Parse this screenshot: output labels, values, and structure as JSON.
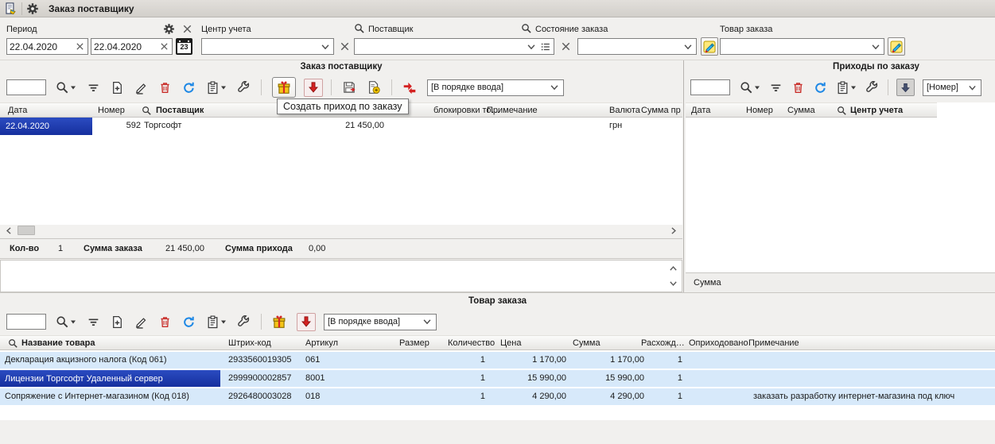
{
  "titlebar": {
    "title": "Заказ поставщику"
  },
  "filterbar": {
    "period": {
      "label": "Период",
      "date_from": "22.04.2020",
      "date_to": "22.04.2020",
      "calendar": "23"
    },
    "center": {
      "label": "Центр учета"
    },
    "supplier": {
      "label": "Поставщик"
    },
    "state": {
      "label": "Состояние заказа"
    },
    "product": {
      "label": "Товар заказа"
    }
  },
  "order_panel": {
    "title": "Заказ поставщику",
    "sort_order": "[В порядке ввода]",
    "tooltip": "Создать приход по заказу",
    "cols": {
      "date": "Дата",
      "number": "Номер",
      "supplier": "Поставщик",
      "block": "блокировки то…",
      "note": "Примечание",
      "currency": "Валюта",
      "sum_receipt": "Сумма пр"
    },
    "row": {
      "date": "22.04.2020",
      "number": "592",
      "supplier": "Торгсофт",
      "sum": "21 450,00",
      "currency": "грн"
    },
    "stats": {
      "count_label": "Кол-во",
      "count": "1",
      "order_sum_label": "Сумма заказа",
      "order_sum": "21 450,00",
      "receipt_sum_label": "Сумма прихода",
      "receipt_sum": "0,00"
    }
  },
  "receipts_panel": {
    "title": "Приходы по заказу",
    "sort_order": "[Номер]",
    "cols": {
      "date": "Дата",
      "number": "Номер",
      "sum": "Сумма",
      "center": "Центр учета"
    },
    "footer": {
      "sum_label": "Сумма"
    }
  },
  "product_panel": {
    "title": "Товар заказа",
    "sort_order": "[В порядке ввода]",
    "cols": {
      "name": "Название товара",
      "barcode": "Штрих-код",
      "article": "Артикул",
      "size": "Размер",
      "qty": "Количество",
      "price": "Цена",
      "sum": "Сумма",
      "diff": "Расхожд…",
      "received": "Оприходовано",
      "note": "Примечание"
    },
    "rows": [
      {
        "name": "Декларация акцизного налога (Код 061)",
        "barcode": "2933560019305",
        "article": "061",
        "qty": "1",
        "price": "1 170,00",
        "sum": "1 170,00",
        "diff": "1",
        "note": ""
      },
      {
        "name": "Лицензии Торгсофт Удаленный сервер",
        "barcode": "2999900002857",
        "article": "8001",
        "qty": "1",
        "price": "15 990,00",
        "sum": "15 990,00",
        "diff": "1",
        "note": ""
      },
      {
        "name": "Сопряжение с Интернет-магазином (Код 018)",
        "barcode": "2926480003028",
        "article": "018",
        "qty": "1",
        "price": "4 290,00",
        "sum": "4 290,00",
        "diff": "1",
        "note": "заказать разработку интернет-магазина под ключ"
      }
    ]
  },
  "colors": {
    "selection_blue": "#1e3bb0",
    "row_light_blue": "#d7e9fa",
    "delete_red": "#c9302c",
    "refresh_blue": "#1e88e5",
    "gift_yellow": "#f5c518"
  }
}
